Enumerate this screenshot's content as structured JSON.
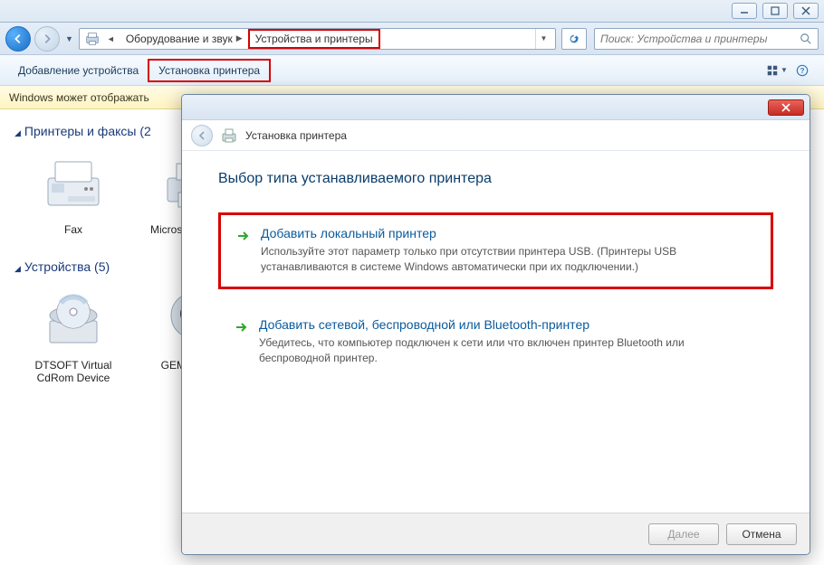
{
  "titlebar": {},
  "breadcrumb": {
    "seg1": "Оборудование и звук",
    "seg2": "Устройства и принтеры"
  },
  "search": {
    "placeholder": "Поиск: Устройства и принтеры"
  },
  "cmdbar": {
    "add_device": "Добавление устройства",
    "add_printer": "Установка принтера"
  },
  "infobar": {
    "text": "Windows может отображать"
  },
  "sections": {
    "printers_header": "Принтеры и факсы (2",
    "devices_header": "Устройства (5)"
  },
  "icons": {
    "fax": "Fax",
    "micr": "Microsoft XPS Document",
    "dtsoft": "DTSOFT Virtual CdRom Device",
    "gemix": "GEMIX USB"
  },
  "dialog": {
    "header_title": "Установка принтера",
    "heading": "Выбор типа устанавливаемого принтера",
    "option1_title": "Добавить локальный принтер",
    "option1_desc": "Используйте этот параметр только при отсутствии принтера USB. (Принтеры USB устанавливаются в системе Windows автоматически при их подключении.)",
    "option2_title": "Добавить сетевой, беспроводной или Bluetooth-принтер",
    "option2_desc": "Убедитесь, что компьютер подключен к сети или что включен принтер Bluetooth или беспроводной принтер.",
    "next": "Далее",
    "cancel": "Отмена"
  }
}
